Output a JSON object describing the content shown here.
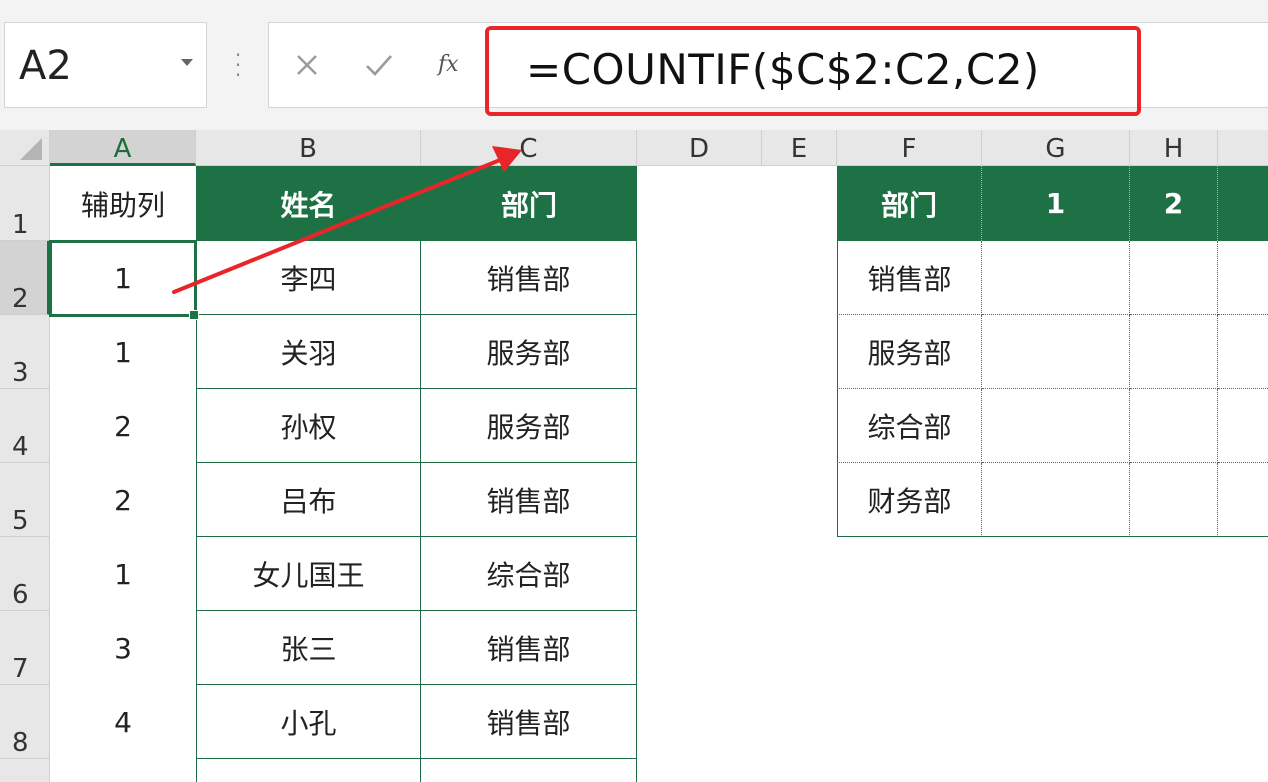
{
  "name_box": {
    "value": "A2"
  },
  "formula_bar": {
    "cancel_icon": "x-icon",
    "enter_icon": "check-icon",
    "fx_label": "fx",
    "formula": "=COUNTIF($C$2:C2,C2)"
  },
  "colors": {
    "header_green": "#1e7145",
    "annotation_red": "#e8262a"
  },
  "columns": [
    "A",
    "B",
    "C",
    "D",
    "E",
    "F",
    "G",
    "H"
  ],
  "rows": [
    "1",
    "2",
    "3",
    "4",
    "5",
    "6",
    "7",
    "8"
  ],
  "table1": {
    "headers": [
      "辅助列",
      "姓名",
      "部门"
    ],
    "rows": [
      [
        "1",
        "李四",
        "销售部"
      ],
      [
        "1",
        "关羽",
        "服务部"
      ],
      [
        "2",
        "孙权",
        "服务部"
      ],
      [
        "2",
        "吕布",
        "销售部"
      ],
      [
        "1",
        "女儿国王",
        "综合部"
      ],
      [
        "3",
        "张三",
        "销售部"
      ],
      [
        "4",
        "小孔",
        "销售部"
      ]
    ]
  },
  "table2": {
    "headers": [
      "部门",
      "1",
      "2"
    ],
    "depts": [
      "销售部",
      "服务部",
      "综合部",
      "财务部"
    ]
  }
}
